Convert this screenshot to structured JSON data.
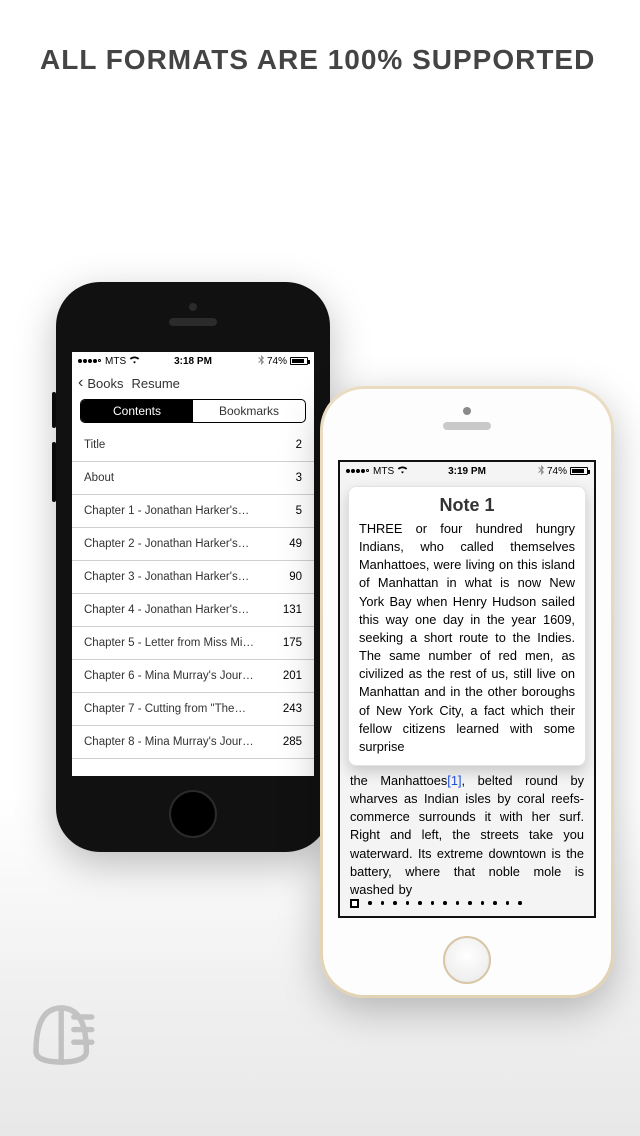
{
  "headline": "ALL FORMATS ARE 100% SUPPORTED",
  "phoneA": {
    "status": {
      "carrier": "MTS",
      "time": "3:18 PM",
      "battery": "74%"
    },
    "nav": {
      "back": "Books",
      "title": "Resume"
    },
    "segments": {
      "contents": "Contents",
      "bookmarks": "Bookmarks"
    },
    "toc": [
      {
        "label": "Title",
        "page": "2"
      },
      {
        "label": "About",
        "page": "3"
      },
      {
        "label": "Chapter 1 - Jonathan Harker's…",
        "page": "5"
      },
      {
        "label": "Chapter 2 - Jonathan Harker's…",
        "page": "49"
      },
      {
        "label": "Chapter 3 - Jonathan Harker's…",
        "page": "90"
      },
      {
        "label": "Chapter 4 - Jonathan Harker's…",
        "page": "131"
      },
      {
        "label": "Chapter 5 - Letter from Miss Mi…",
        "page": "175"
      },
      {
        "label": "Chapter 6 - Mina Murray's Jour…",
        "page": "201"
      },
      {
        "label": "Chapter 7 - Cutting from \"The…",
        "page": "243"
      },
      {
        "label": "Chapter 8 - Mina Murray's Jour…",
        "page": "285"
      }
    ]
  },
  "phoneB": {
    "status": {
      "carrier": "MTS",
      "time": "3:19 PM",
      "battery": "74%"
    },
    "note": {
      "title": "Note 1",
      "body": "THREE or four hundred hungry Indians, who called themselves Manhattoes, were living on this island of Manhattan in what is now New York Bay when Henry Hudson sailed this way one day in the year 1609, seeking a short route to the Indies. The same number of red men, as civilized as the rest of us, still live on Manhattan and in the other boroughs of New York City, a fact which their fellow citizens learned with some surprise"
    },
    "rest_pre": "the Manhattoes",
    "rest_ref": "[1]",
    "rest_post": ", belted round by wharves as Indian isles by coral reefs-commerce surrounds it with her surf. Right and left, the streets take you waterward. Its extreme downtown is the battery, where that noble mole is washed by"
  }
}
